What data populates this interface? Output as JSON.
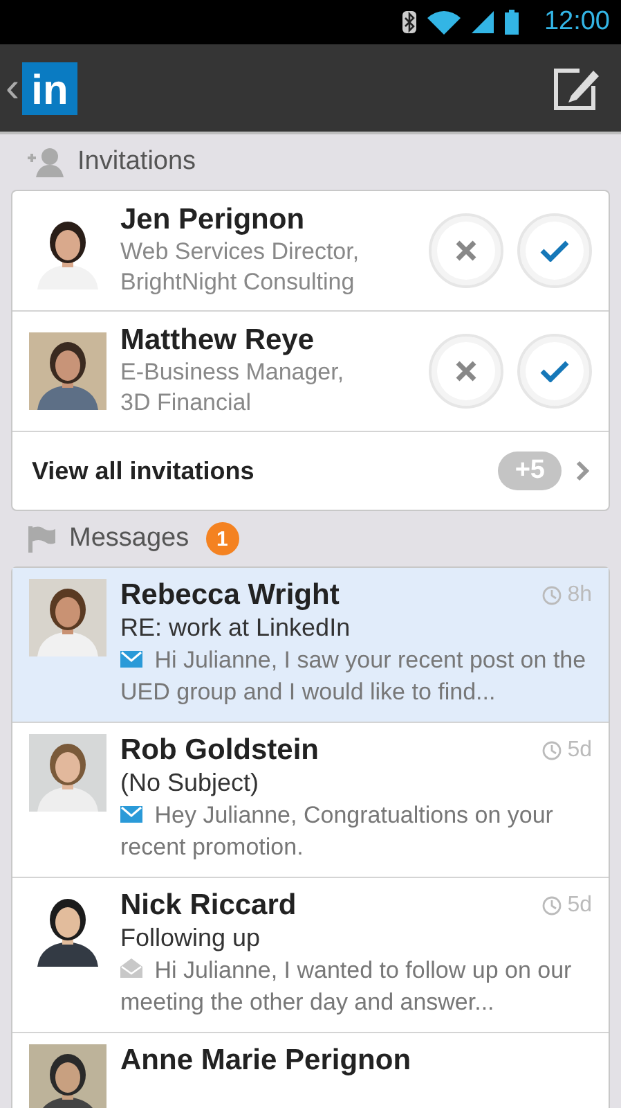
{
  "status_bar": {
    "time": "12:00"
  },
  "action_bar": {
    "back": "‹",
    "logo_text": "in"
  },
  "invitations": {
    "title": "Invitations",
    "items": [
      {
        "name": "Jen Perignon",
        "title": "Web Services Director,",
        "company": "BrightNight Consulting"
      },
      {
        "name": "Matthew Reye",
        "title": "E-Business Manager,",
        "company": "3D Financial"
      }
    ],
    "view_all": {
      "label": "View all invitations",
      "count": "+5"
    }
  },
  "messages": {
    "title": "Messages",
    "badge": "1",
    "items": [
      {
        "sender": "Rebecca Wright",
        "subject": "RE: work at LinkedIn",
        "preview": "Hi Julianne, I saw your recent post on the UED group and I would like to find...",
        "time": "8h",
        "selected": true,
        "unread": true
      },
      {
        "sender": "Rob Goldstein",
        "subject": "(No Subject)",
        "preview": "Hey Julianne, Congratualtions on your recent promotion.",
        "time": "5d",
        "selected": false,
        "unread": true
      },
      {
        "sender": "Nick Riccard",
        "subject": "Following up",
        "preview": "Hi Julianne, I wanted to follow up on our meeting the other day and answer...",
        "time": "5d",
        "selected": false,
        "unread": false
      },
      {
        "sender": "Anne Marie Perignon",
        "selected": false
      }
    ]
  }
}
